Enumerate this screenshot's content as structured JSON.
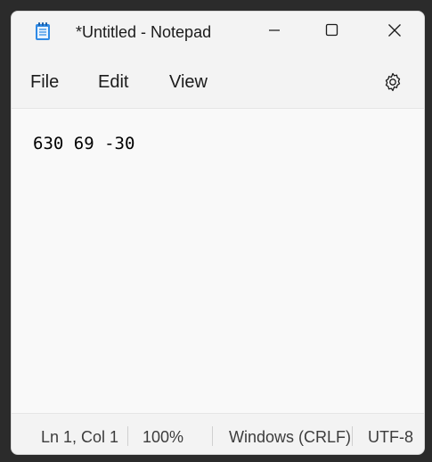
{
  "window": {
    "title": "*Untitled - Notepad"
  },
  "menu": {
    "file": "File",
    "edit": "Edit",
    "view": "View"
  },
  "icons": {
    "app": "notepad-icon",
    "minimize": "minimize-icon",
    "maximize": "maximize-icon",
    "close": "close-icon",
    "settings": "gear-icon"
  },
  "editor": {
    "content": "630 69 -30"
  },
  "status": {
    "position": "Ln 1, Col 1",
    "zoom": "100%",
    "line_ending": "Windows (CRLF)",
    "encoding": "UTF-8"
  },
  "colors": {
    "background": "#f3f3f3",
    "editor": "#f9f9f9",
    "icon_blue": "#1e88e5"
  }
}
